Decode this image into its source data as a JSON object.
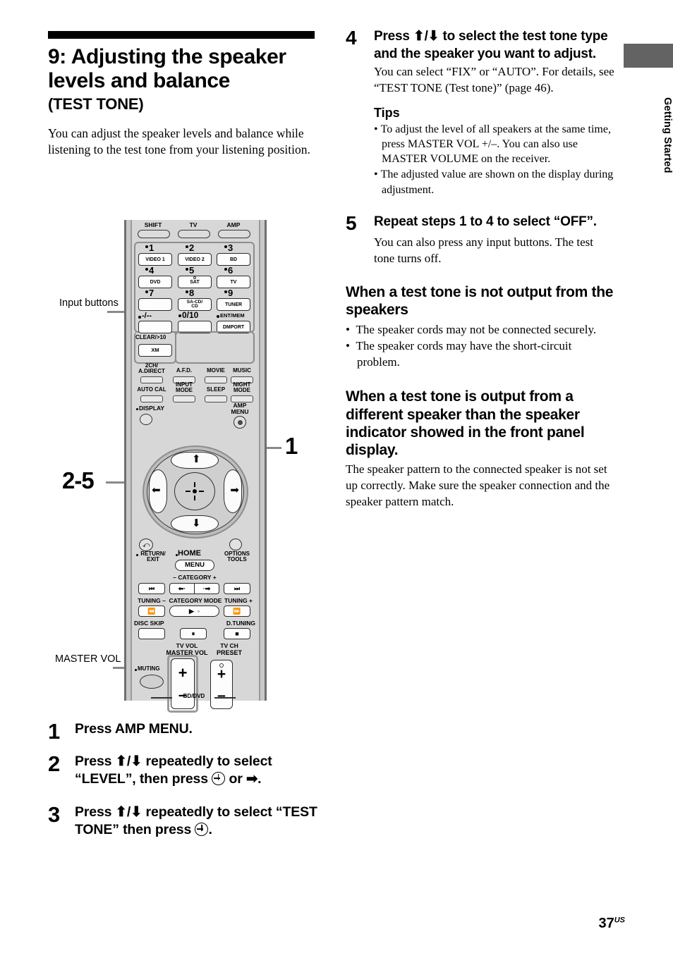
{
  "side_tab": {
    "label": "Getting Started"
  },
  "left": {
    "title": "9: Adjusting the speaker levels and balance",
    "subtitle": "(TEST TONE)",
    "intro": "You can adjust the speaker levels and balance while listening to the test tone from your listening position."
  },
  "callouts": {
    "input_buttons": "Input\nbuttons",
    "master_vol": "MASTER\nVOL +/–",
    "num_2_5": "2-5",
    "num_1": "1"
  },
  "remote": {
    "top_row": [
      "SHIFT",
      "TV",
      "AMP"
    ],
    "keypad": [
      {
        "num": "1",
        "label": "VIDEO 1"
      },
      {
        "num": "2",
        "label": "VIDEO 2"
      },
      {
        "num": "3",
        "label": "BD"
      },
      {
        "num": "4",
        "label": "DVD"
      },
      {
        "num": "5",
        "label": "SAT"
      },
      {
        "num": "6",
        "label": "TV"
      },
      {
        "num": "7",
        "label": ""
      },
      {
        "num": "8",
        "label": "SA-CD/\nCD"
      },
      {
        "num": "9",
        "label": "TUNER"
      },
      {
        "num": "-/--",
        "label": ""
      },
      {
        "num": "0/10",
        "label": ""
      },
      {
        "num": "ENT/MEM",
        "label": "DMPORT"
      }
    ],
    "clear_label": "CLEAR/>10",
    "xm_label": "XM",
    "mode_row1": [
      "2CH/\nA.DIRECT",
      "A.F.D.",
      "MOVIE",
      "MUSIC"
    ],
    "mode_row2": [
      "AUTO CAL",
      "INPUT\nMODE",
      "SLEEP",
      "NIGHT\nMODE"
    ],
    "display_label": "DISPLAY",
    "amp_menu_label": "AMP\nMENU",
    "return_label": "RETURN/\nEXIT",
    "home_label": "HOME",
    "home_button": "MENU",
    "options_label": "OPTIONS\nTOOLS",
    "category_label": "– CATEGORY +",
    "tuning_minus": "TUNING –",
    "category_mode": "CATEGORY MODE",
    "tuning_plus": "TUNING +",
    "disc_skip": "DISC SKIP",
    "d_tuning": "D.TUNING",
    "tv_vol": "TV VOL",
    "master_vol": "MASTER VOL",
    "tv_ch": "TV CH",
    "preset": "PRESET",
    "muting": "MUTING",
    "bd_dvd": "BD/DVD",
    "plus": "+",
    "minus": "–"
  },
  "steps": [
    {
      "num": "1",
      "text": "Press AMP MENU."
    },
    {
      "num": "2",
      "text_a": "Press ⬆/⬇ repeatedly to select “LEVEL”, then press ",
      "text_b": " or ➡."
    },
    {
      "num": "3",
      "text_a": "Press ⬆/⬇ repeatedly to select “TEST TONE” then press ",
      "text_b": "."
    }
  ],
  "right": {
    "step4": {
      "num": "4",
      "head": "Press ⬆/⬇ to select the test tone type and the speaker you want to adjust.",
      "body": "You can select “FIX” or “AUTO”. For details, see “TEST TONE (Test tone)” (page 46).",
      "tips_title": "Tips",
      "tips": [
        "To adjust the level of all speakers at the same time, press MASTER VOL +/–. You can also use MASTER VOLUME on the receiver.",
        "The adjusted value are shown on the display during adjustment."
      ]
    },
    "step5": {
      "num": "5",
      "head": "Repeat steps 1 to 4 to select “OFF”.",
      "body": "You can also press any input buttons. The test tone turns off."
    },
    "section1": {
      "heading": "When a test tone is not output from the speakers",
      "items": [
        "The speaker cords may not be connected securely.",
        "The speaker cords may have the short-circuit problem."
      ]
    },
    "section2": {
      "heading": "When a test tone is output from a different speaker than the speaker indicator showed in the front panel display.",
      "body": "The speaker pattern to the connected speaker is not set up correctly. Make sure the speaker connection and the speaker pattern match."
    }
  },
  "footer": {
    "page": "37",
    "region": "US"
  }
}
